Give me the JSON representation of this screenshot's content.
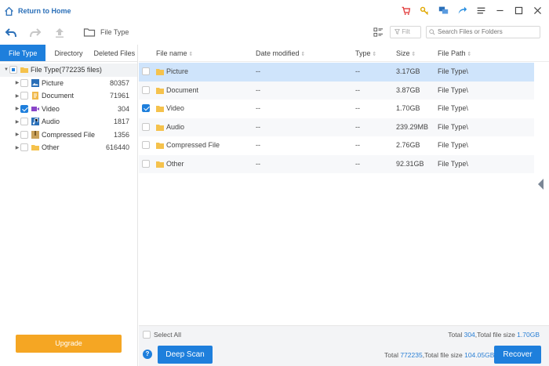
{
  "titlebar": {
    "home_label": "Return to Home",
    "icons": [
      "cart-icon",
      "key-icon",
      "chat-icon",
      "share-icon",
      "menu-icon",
      "minimize-icon",
      "maximize-icon",
      "close-icon"
    ]
  },
  "toolbar": {
    "breadcrumb": "File Type",
    "filter_placeholder": "Filt",
    "search_placeholder": "Search Files or Folders"
  },
  "left": {
    "tabs": [
      "File Type",
      "Directory",
      "Deleted Files"
    ],
    "root_label": "File Type(772235 files)",
    "items": [
      {
        "label": "Picture",
        "count": "80357",
        "checked": false
      },
      {
        "label": "Document",
        "count": "71961",
        "checked": false
      },
      {
        "label": "Video",
        "count": "304",
        "checked": true
      },
      {
        "label": "Audio",
        "count": "1817",
        "checked": false
      },
      {
        "label": "Compressed File",
        "count": "1356",
        "checked": false
      },
      {
        "label": "Other",
        "count": "616440",
        "checked": false
      }
    ],
    "upgrade_label": "Upgrade"
  },
  "table": {
    "columns": [
      "File name",
      "Date modified",
      "Type",
      "Size",
      "File Path"
    ],
    "rows": [
      {
        "name": "Picture",
        "date": "--",
        "type": "--",
        "size": "3.17GB",
        "path": "File Type\\",
        "checked": false
      },
      {
        "name": "Document",
        "date": "--",
        "type": "--",
        "size": "3.87GB",
        "path": "File Type\\",
        "checked": false
      },
      {
        "name": "Video",
        "date": "--",
        "type": "--",
        "size": "1.70GB",
        "path": "File Type\\",
        "checked": true
      },
      {
        "name": "Audio",
        "date": "--",
        "type": "--",
        "size": "239.29MB",
        "path": "File Type\\",
        "checked": false
      },
      {
        "name": "Compressed File",
        "date": "--",
        "type": "--",
        "size": "2.76GB",
        "path": "File Type\\",
        "checked": false
      },
      {
        "name": "Other",
        "date": "--",
        "type": "--",
        "size": "92.31GB",
        "path": "File Type\\",
        "checked": false
      }
    ]
  },
  "footer": {
    "select_all": "Select All",
    "sel_total_prefix": "Total ",
    "sel_count": "304",
    "sel_size_prefix": ",Total file size ",
    "sel_size": "1.70GB",
    "deep_scan": "Deep Scan",
    "all_total_prefix": "Total ",
    "all_count": "772235",
    "all_size_prefix": ",Total file size ",
    "all_size": "104.05GB",
    "recover": "Recover",
    "help": "?"
  },
  "colors": {
    "accent": "#1e7fdc",
    "upgrade": "#f5a623",
    "selected_row": "#cfe4fb"
  }
}
